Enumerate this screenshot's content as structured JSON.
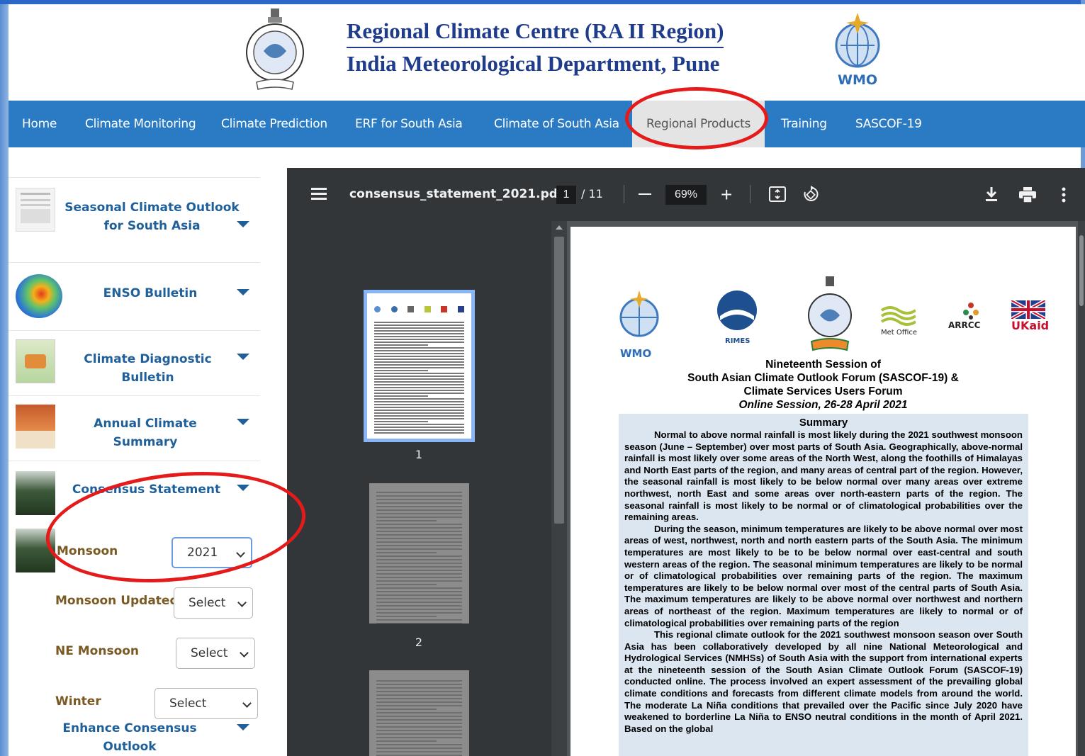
{
  "header": {
    "title_line1": "Regional Climate Centre (RA II Region)",
    "title_line2": "India Meteorological Department, Pune",
    "wmo_logo_text": "WMO"
  },
  "navbar": {
    "items": [
      {
        "label": "Home"
      },
      {
        "label": "Climate Monitoring"
      },
      {
        "label": "Climate Prediction"
      },
      {
        "label": "ERF for South Asia"
      },
      {
        "label": "Climate of South Asia"
      },
      {
        "label": "Regional Products",
        "active": true
      },
      {
        "label": "Training"
      },
      {
        "label": "SASCOF-19"
      }
    ]
  },
  "sidebar": {
    "items": [
      {
        "label": "Seasonal Climate Outlook for South Asia"
      },
      {
        "label": "ENSO Bulletin"
      },
      {
        "label": "Climate Diagnostic Bulletin"
      },
      {
        "label": "Annual Climate Summary"
      },
      {
        "label": "Consensus Statement"
      }
    ],
    "sub_items": [
      {
        "label": "Monsoon",
        "selected": "2021"
      },
      {
        "label": "Monsoon Updated",
        "selected": "Select"
      },
      {
        "label": "NE Monsoon",
        "selected": "Select"
      },
      {
        "label": "Winter",
        "selected": "Select"
      }
    ],
    "footer_item": {
      "label": "Enhance Consensus Outlook"
    }
  },
  "pdf_viewer": {
    "filename": "consensus_statement_2021.pdf",
    "current_page": "1",
    "total_pages": "/ 11",
    "zoom": "69%",
    "thumbnails": [
      {
        "label": "1"
      },
      {
        "label": "2"
      }
    ],
    "icons": [
      "menu-icon",
      "zoom-out-icon",
      "zoom-in-icon",
      "fit-page-icon",
      "rotate-icon",
      "download-icon",
      "print-icon",
      "more-options-icon"
    ]
  },
  "document": {
    "logos": [
      "WMO",
      "RIMES",
      "Met Office",
      "ARRCC",
      "UKaid"
    ],
    "heading1": "Nineteenth Session of",
    "heading2": "South Asian Climate Outlook Forum (SASCOF-19) &",
    "heading3": "Climate Services Users Forum",
    "heading4": "Online Session, 26-28 April 2021",
    "summary_title": "Summary",
    "paragraphs": [
      "Normal to above normal rainfall is most likely during the 2021 southwest monsoon season (June – September) over most parts of South Asia. Geographically, above-normal rainfall is most likely over some areas of the North West, along the foothills of Himalayas and North East parts of the region, and many areas of central part of the region. However, the seasonal rainfall is most likely to be below normal over many areas over extreme northwest, north East and some areas over north-eastern parts of the region. The seasonal rainfall is most likely to be normal or of climatological probabilities over the remaining areas.",
      "During the season, minimum temperatures are likely to be above normal over most areas of west, northwest, north and north eastern parts of the South Asia. The minimum temperatures are most likely to be to be below normal over east-central and south western areas of the region. The seasonal minimum temperatures are likely to be normal or of climatological probabilities over remaining parts of the region. The maximum temperatures are likely to be below normal over most of the central parts of South Asia. The maximum temperatures are likely to be above normal over northwest and northern areas of northeast of the region. Maximum temperatures are likely to normal or of climatological probabilities over remaining parts of the region",
      "This regional climate outlook for the 2021 southwest monsoon season over South Asia has been collaboratively developed by all nine National Meteorological and Hydrological Services (NMHSs) of South Asia with the support from international experts at the nineteenth session of the South Asian Climate Outlook Forum (SASCOF-19) conducted online. The process involved an expert assessment of the prevailing global climate conditions and forecasts from different climate models from around the world. The moderate La Niña conditions that prevailed over the Pacific since July 2020 have weakened to borderline La Niña to ENSO neutral conditions in the month of April 2021. Based on the global"
    ]
  },
  "colors": {
    "navbar": "#2b7bc4",
    "title": "#1f3b8c",
    "sidebar_link": "#1f5f9a",
    "annotation": "#e51b1b",
    "pdf_toolbar": "#323639"
  }
}
